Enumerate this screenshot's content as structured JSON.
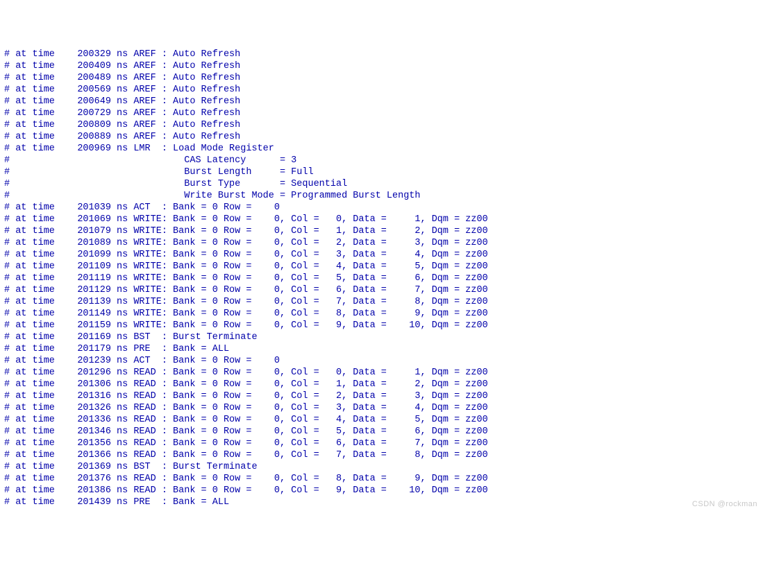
{
  "watermark": "CSDN @rockman",
  "lines": [
    {
      "mark": "#",
      "time": "200329",
      "cmd": "AREF",
      "rest": "Auto Refresh"
    },
    {
      "mark": "#",
      "time": "200409",
      "cmd": "AREF",
      "rest": "Auto Refresh"
    },
    {
      "mark": "#",
      "time": "200489",
      "cmd": "AREF",
      "rest": "Auto Refresh"
    },
    {
      "mark": "#",
      "time": "200569",
      "cmd": "AREF",
      "rest": "Auto Refresh"
    },
    {
      "mark": "#",
      "time": "200649",
      "cmd": "AREF",
      "rest": "Auto Refresh"
    },
    {
      "mark": "#",
      "time": "200729",
      "cmd": "AREF",
      "rest": "Auto Refresh"
    },
    {
      "mark": "#",
      "time": "200809",
      "cmd": "AREF",
      "rest": "Auto Refresh"
    },
    {
      "mark": "#",
      "time": "200889",
      "cmd": "AREF",
      "rest": "Auto Refresh"
    },
    {
      "mark": "#",
      "time": "200969",
      "cmd": "LMR",
      "rest": "Load Mode Register"
    },
    {
      "mark": "#",
      "kvkey": "CAS Latency",
      "kvval": "3"
    },
    {
      "mark": "#",
      "kvkey": "Burst Length",
      "kvval": "Full"
    },
    {
      "mark": "#",
      "kvkey": "Burst Type",
      "kvval": "Sequential"
    },
    {
      "mark": "#",
      "kvkey": "Write Burst Mode",
      "kvval": "Programmed Burst Length"
    },
    {
      "mark": "#",
      "time": "201039",
      "cmd": "ACT",
      "bank": "0",
      "row": "0"
    },
    {
      "mark": "#",
      "time": "201069",
      "cmd": "WRITE",
      "bank": "0",
      "row": "0",
      "col": "0",
      "data": "1",
      "dqm": "zz00"
    },
    {
      "mark": "#",
      "time": "201079",
      "cmd": "WRITE",
      "bank": "0",
      "row": "0",
      "col": "1",
      "data": "2",
      "dqm": "zz00"
    },
    {
      "mark": "#",
      "time": "201089",
      "cmd": "WRITE",
      "bank": "0",
      "row": "0",
      "col": "2",
      "data": "3",
      "dqm": "zz00"
    },
    {
      "mark": "#",
      "time": "201099",
      "cmd": "WRITE",
      "bank": "0",
      "row": "0",
      "col": "3",
      "data": "4",
      "dqm": "zz00"
    },
    {
      "mark": "#",
      "time": "201109",
      "cmd": "WRITE",
      "bank": "0",
      "row": "0",
      "col": "4",
      "data": "5",
      "dqm": "zz00"
    },
    {
      "mark": "#",
      "time": "201119",
      "cmd": "WRITE",
      "bank": "0",
      "row": "0",
      "col": "5",
      "data": "6",
      "dqm": "zz00"
    },
    {
      "mark": "#",
      "time": "201129",
      "cmd": "WRITE",
      "bank": "0",
      "row": "0",
      "col": "6",
      "data": "7",
      "dqm": "zz00"
    },
    {
      "mark": "#",
      "time": "201139",
      "cmd": "WRITE",
      "bank": "0",
      "row": "0",
      "col": "7",
      "data": "8",
      "dqm": "zz00"
    },
    {
      "mark": "#",
      "time": "201149",
      "cmd": "WRITE",
      "bank": "0",
      "row": "0",
      "col": "8",
      "data": "9",
      "dqm": "zz00"
    },
    {
      "mark": "#",
      "time": "201159",
      "cmd": "WRITE",
      "bank": "0",
      "row": "0",
      "col": "9",
      "data": "10",
      "dqm": "zz00"
    },
    {
      "mark": "#",
      "time": "201169",
      "cmd": "BST",
      "rest": "Burst Terminate"
    },
    {
      "mark": "#",
      "time": "201179",
      "cmd": "PRE",
      "rest": "Bank = ALL"
    },
    {
      "mark": "#",
      "time": "201239",
      "cmd": "ACT",
      "bank": "0",
      "row": "0"
    },
    {
      "mark": "#",
      "time": "201296",
      "cmd": "READ",
      "bank": "0",
      "row": "0",
      "col": "0",
      "data": "1",
      "dqm": "zz00"
    },
    {
      "mark": "#",
      "time": "201306",
      "cmd": "READ",
      "bank": "0",
      "row": "0",
      "col": "1",
      "data": "2",
      "dqm": "zz00"
    },
    {
      "mark": "#",
      "time": "201316",
      "cmd": "READ",
      "bank": "0",
      "row": "0",
      "col": "2",
      "data": "3",
      "dqm": "zz00"
    },
    {
      "mark": "#",
      "time": "201326",
      "cmd": "READ",
      "bank": "0",
      "row": "0",
      "col": "3",
      "data": "4",
      "dqm": "zz00"
    },
    {
      "mark": "#",
      "time": "201336",
      "cmd": "READ",
      "bank": "0",
      "row": "0",
      "col": "4",
      "data": "5",
      "dqm": "zz00"
    },
    {
      "mark": "#",
      "time": "201346",
      "cmd": "READ",
      "bank": "0",
      "row": "0",
      "col": "5",
      "data": "6",
      "dqm": "zz00"
    },
    {
      "mark": "#",
      "time": "201356",
      "cmd": "READ",
      "bank": "0",
      "row": "0",
      "col": "6",
      "data": "7",
      "dqm": "zz00"
    },
    {
      "mark": "#",
      "time": "201366",
      "cmd": "READ",
      "bank": "0",
      "row": "0",
      "col": "7",
      "data": "8",
      "dqm": "zz00"
    },
    {
      "mark": "#",
      "time": "201369",
      "cmd": "BST",
      "rest": "Burst Terminate"
    },
    {
      "mark": "#",
      "time": "201376",
      "cmd": "READ",
      "bank": "0",
      "row": "0",
      "col": "8",
      "data": "9",
      "dqm": "zz00"
    },
    {
      "mark": "#",
      "time": "201386",
      "cmd": "READ",
      "bank": "0",
      "row": "0",
      "col": "9",
      "data": "10",
      "dqm": "zz00"
    },
    {
      "mark": "#",
      "time": "201439",
      "cmd": "PRE",
      "rest": "Bank = ALL"
    }
  ]
}
